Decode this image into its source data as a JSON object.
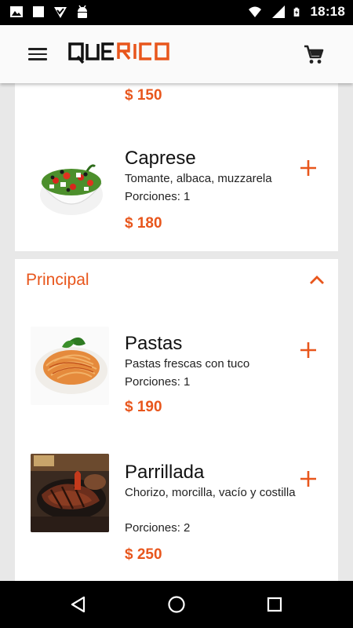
{
  "status_bar": {
    "time": "18:18",
    "icons": [
      "image-icon",
      "square-icon",
      "check-icon",
      "android-icon",
      "wifi-icon",
      "signal-icon",
      "battery-charging-icon"
    ]
  },
  "app_bar": {
    "logo_text": "QUERICO",
    "menu_icon": "hamburger-menu-icon",
    "cart_icon": "shopping-cart-icon"
  },
  "previous_item": {
    "price": "$ 150"
  },
  "sections": [
    {
      "title": "Principal",
      "expanded": true
    }
  ],
  "items": [
    {
      "title": "Caprese",
      "description": "Tomante, albaca, muzzarela",
      "portions": "Porciones: 1",
      "price": "$ 180",
      "image": "salad"
    },
    {
      "title": "Pastas",
      "description": "Pastas frescas con tuco",
      "portions": "Porciones: 1",
      "price": "$ 190",
      "image": "pasta"
    },
    {
      "title": "Parrillada",
      "description": "Chorizo, morcilla, vacío y costilla",
      "portions": "Porciones: 2",
      "price": "$ 250",
      "image": "grill"
    }
  ],
  "colors": {
    "accent": "#e8561c",
    "background": "#e8e8e8",
    "card": "#ffffff"
  },
  "nav_bar": {
    "icons": [
      "back-icon",
      "home-icon",
      "recents-icon"
    ]
  }
}
